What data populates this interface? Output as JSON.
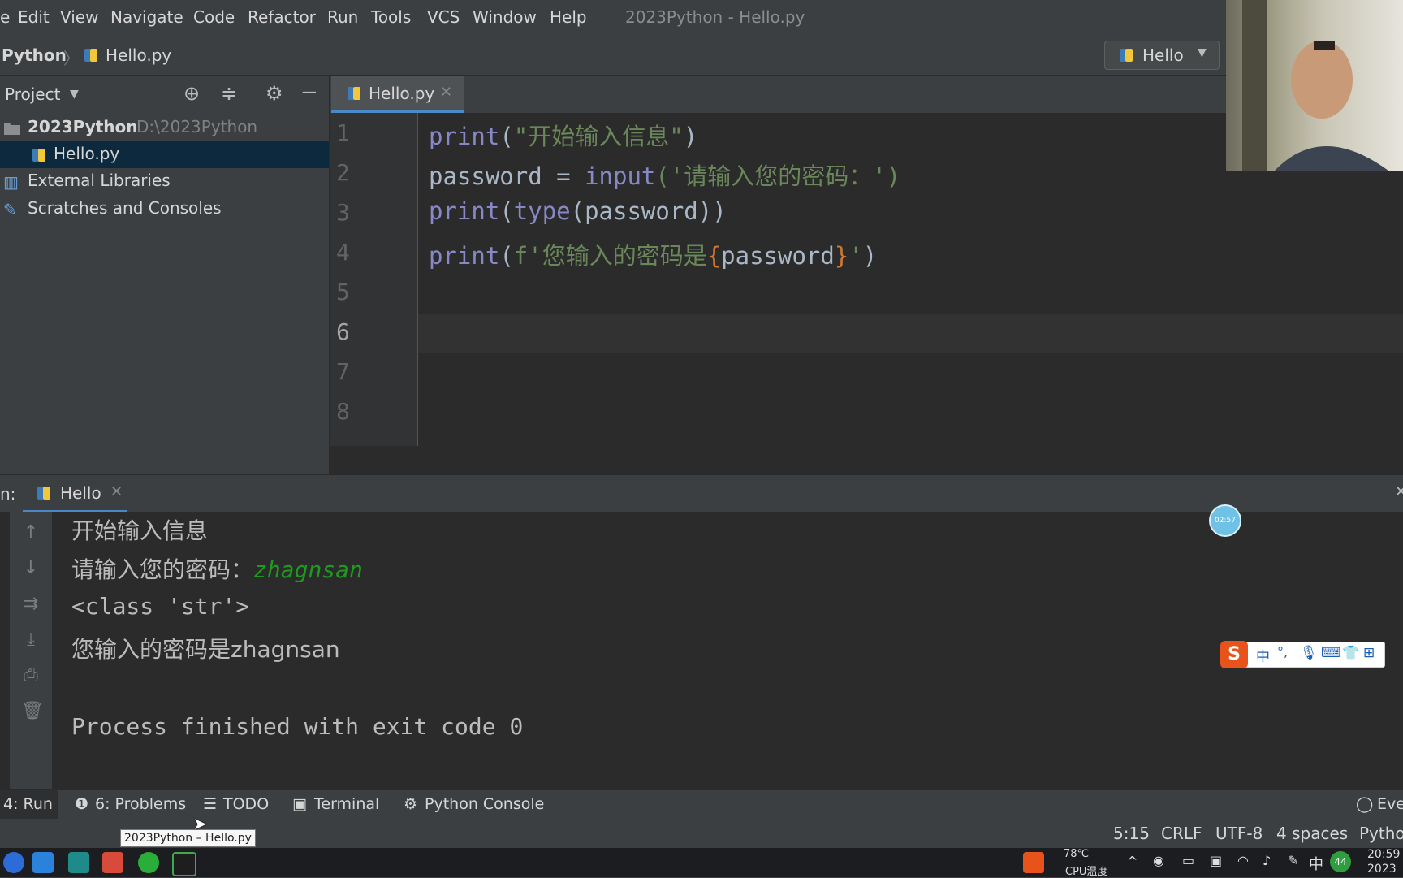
{
  "menu": [
    "e",
    "Edit",
    "View",
    "Navigate",
    "Code",
    "Refactor",
    "Run",
    "Tools",
    "VCS",
    "Window",
    "Help"
  ],
  "window_title": "2023Python - Hello.py",
  "breadcrumb": {
    "project": "Python",
    "file": "Hello.py"
  },
  "run_config": "Hello",
  "project_panel": {
    "title": "Project",
    "root_name": "2023Python",
    "root_path": "D:\\2023Python",
    "file": "Hello.py",
    "external": "External Libraries",
    "scratches": "Scratches and Consoles"
  },
  "editor": {
    "tab_label": "Hello.py",
    "line_numbers": [
      "1",
      "2",
      "3",
      "4",
      "5",
      "6",
      "7",
      "8"
    ],
    "lines": [
      {
        "a": "print",
        "b": "(",
        "c": "\"开始输入信息\"",
        "d": ")"
      },
      {
        "a": "password = ",
        "b": "input",
        "c": "('",
        "d": "请输入您的密码：",
        "e": "')"
      },
      {
        "a": "print",
        "b": "(",
        "c": "type",
        "d": "(password))"
      },
      {
        "a": "print",
        "b": "(",
        "c": "f'您输入的密码是",
        "d": "{",
        "e": "password",
        "f": "}",
        "g": "'",
        "h": ")"
      }
    ]
  },
  "run": {
    "panel_prefix": "n:",
    "tab_label": "Hello",
    "output": {
      "line1": "开始输入信息",
      "line2_prompt": "请输入您的密码：",
      "line2_input": "zhagnsan",
      "line3": "<class 'str'>",
      "line4": "您输入的密码是zhagnsan",
      "line5": "Process finished with exit code 0"
    }
  },
  "bottom_tabs": {
    "run": "4: Run",
    "problems": "6: Problems",
    "todo": "TODO",
    "terminal": "Terminal",
    "python_console": "Python Console",
    "event": "Eve"
  },
  "status": {
    "position": "5:15",
    "line_sep": "CRLF",
    "encoding": "UTF-8",
    "indent": "4 spaces",
    "interpreter": "Pytho"
  },
  "tooltip": "2023Python – Hello.py",
  "taskbar": {
    "temp": "78℃",
    "temp_label": "CPU温度",
    "ime": "中",
    "badge": "44",
    "time": "20:59",
    "date": "2023"
  },
  "ime_bar": {
    "lang": "中",
    "punct": "°,"
  },
  "recorder_badge": "02:57",
  "colors": {
    "accent": "#4a88c7",
    "keyword": "#8888c6",
    "string": "#6a8759",
    "brace": "#cc7832",
    "user_input": "#1e9a1e"
  }
}
